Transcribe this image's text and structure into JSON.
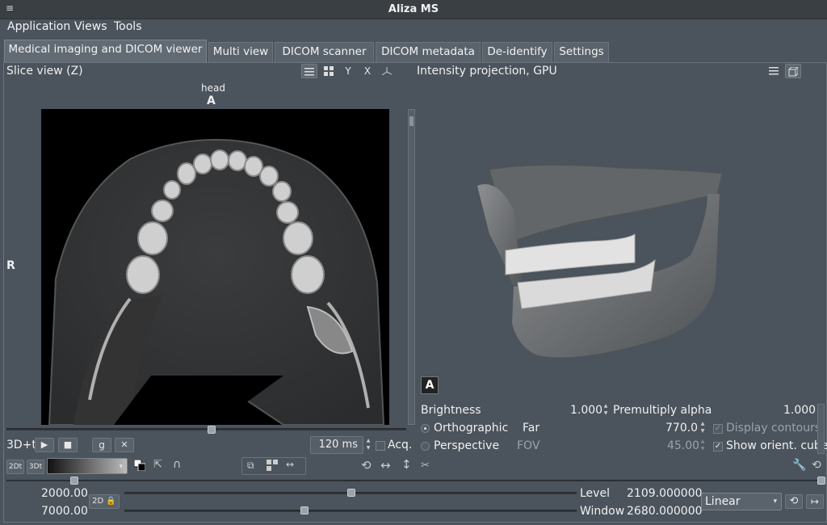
{
  "window": {
    "title": "Aliza MS",
    "menu_glyph": "≡"
  },
  "menubar": {
    "items": [
      "Application",
      "Views",
      "Tools"
    ]
  },
  "tabs": [
    {
      "label": "Medical imaging and DICOM viewer",
      "active": true
    },
    {
      "label": "Multi view"
    },
    {
      "label": "DICOM scanner"
    },
    {
      "label": "DICOM metadata"
    },
    {
      "label": "De-identify"
    },
    {
      "label": "Settings"
    }
  ],
  "slice_view": {
    "title": "Slice view (Z)",
    "toolbar": {
      "list_icon": "list-icon",
      "grid_icon": "grid-icon",
      "y_label": "Y",
      "x_label": "X",
      "axes_icon": "axes-icon"
    },
    "orientation": {
      "top_small": "head",
      "top": "A",
      "left": "R"
    },
    "controls": {
      "anim_label": "3D+t",
      "g_label": "g",
      "interval": "120 ms",
      "acq_label": "Acq.",
      "btn_2dt": "2Dt",
      "btn_3dt": "3Dt"
    }
  },
  "projection_view": {
    "title": "Intensity projection, GPU",
    "cube_label": "A",
    "brightness_label": "Brightness",
    "brightness_value": "1.000",
    "premultiply_label": "Premultiply alpha",
    "premultiply_value": "1.000",
    "orthographic_label": "Orthographic",
    "perspective_label": "Perspective",
    "far_label": "Far",
    "far_value": "770.0",
    "fov_label": "FOV",
    "fov_value": "45.00",
    "display_contours_label": "Display contours",
    "show_cube_label": "Show orient. cube",
    "projection_mode": "orthographic"
  },
  "bottom": {
    "min_value": "2000.00",
    "max_value": "7000.00",
    "lock_label": "2D",
    "level_label": "Level",
    "level_value": "2109.000000",
    "window_label": "Window",
    "window_value": "2680.000000",
    "lut": "Linear"
  },
  "colors": {
    "background": "#4b535c",
    "titlebar": "#3a3f44",
    "panel_border": "#6b747d"
  }
}
